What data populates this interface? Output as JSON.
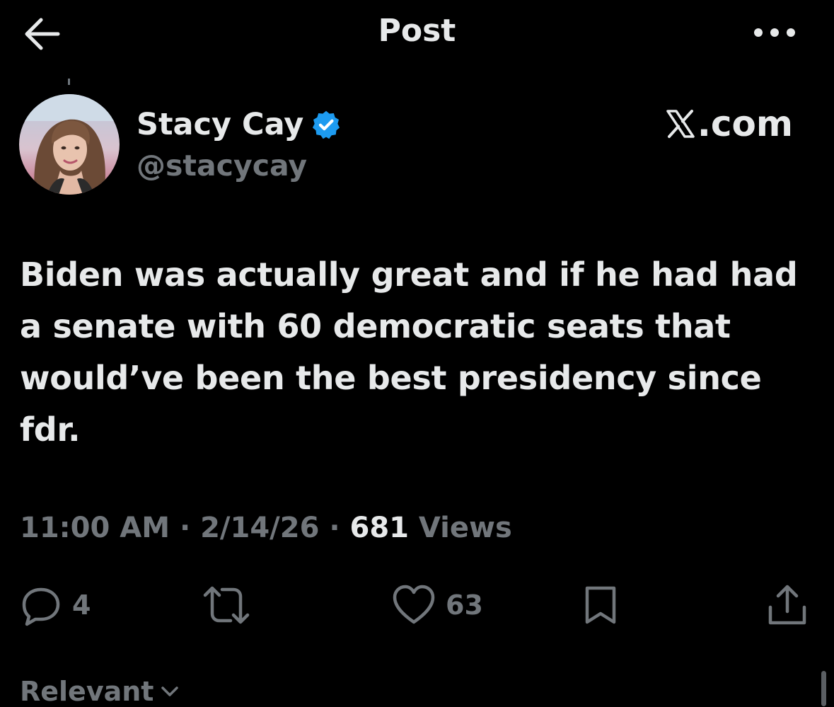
{
  "header": {
    "title": "Post",
    "back_icon": "arrow-left-icon",
    "more_icon": "ellipsis-icon"
  },
  "author": {
    "display_name": "Stacy Cay",
    "handle": "@stacycay",
    "verified_icon": "verified-badge-icon",
    "verified_color": "#1d9bf0"
  },
  "brand": {
    "suffix": ".com",
    "logo_icon": "x-logo-icon"
  },
  "post": {
    "text": "Biden was actually great and if he had had a senate with 60 democratic seats that would’ve been the best presidency since fdr."
  },
  "meta": {
    "time": "11:00 AM",
    "separator": " · ",
    "date": "2/14/26",
    "views_count": "681",
    "views_label": " Views"
  },
  "actions": {
    "replies": "4",
    "likes": "63",
    "reply_icon": "reply-icon",
    "repost_icon": "repost-icon",
    "like_icon": "heart-icon",
    "bookmark_icon": "bookmark-icon",
    "share_icon": "share-icon"
  },
  "sort": {
    "label": "Relevant"
  },
  "colors": {
    "background": "#000000",
    "text_primary": "#e7e9ea",
    "text_secondary": "#71767b",
    "accent": "#1d9bf0"
  }
}
